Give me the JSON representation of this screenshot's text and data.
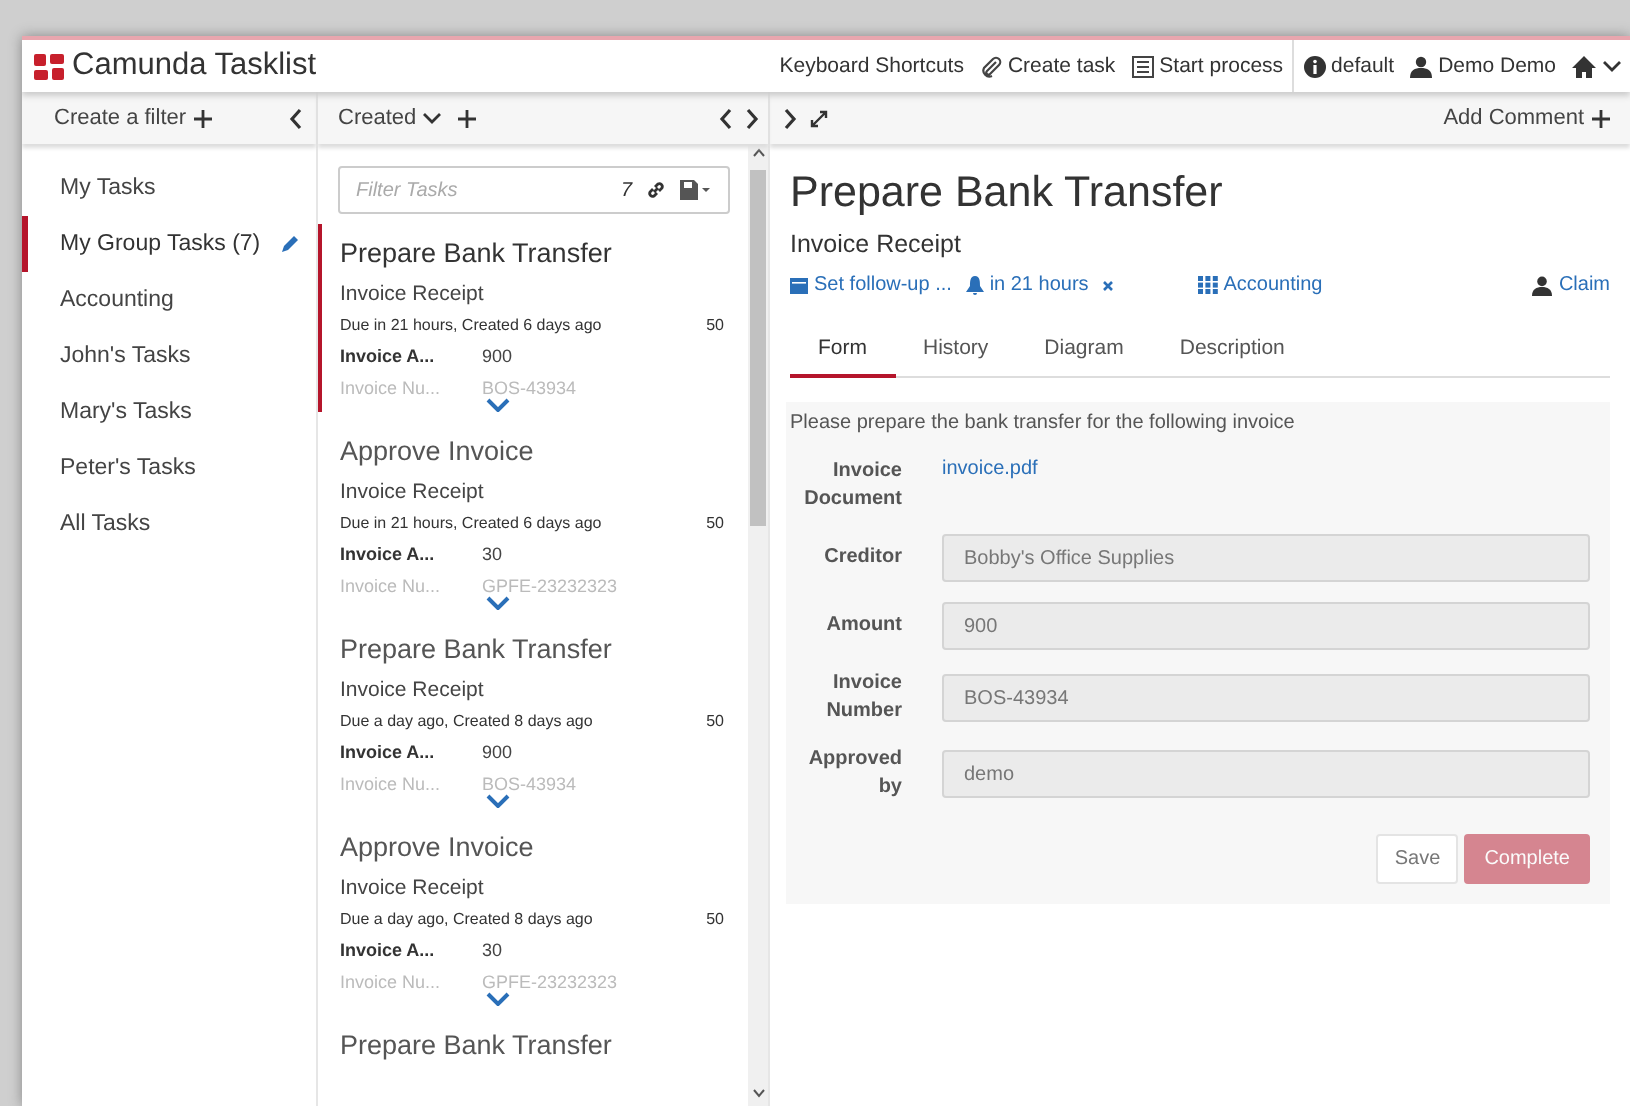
{
  "header": {
    "brand": "Camunda Tasklist",
    "links": [
      {
        "kind": "keyboard",
        "label": "Keyboard Shortcuts"
      },
      {
        "kind": "create",
        "label": "Create task"
      },
      {
        "kind": "start",
        "label": "Start process"
      },
      {
        "kind": "engine",
        "label": "default"
      },
      {
        "kind": "user",
        "label": "Demo Demo"
      },
      {
        "kind": "home"
      }
    ]
  },
  "filters": {
    "create_label": "Create a filter",
    "items": [
      {
        "label": "My Tasks",
        "selected": false
      },
      {
        "label": "My Group Tasks",
        "count": "(7)",
        "selected": true
      },
      {
        "label": "Accounting",
        "selected": false
      },
      {
        "label": "John's Tasks",
        "selected": false
      },
      {
        "label": "Mary's Tasks",
        "selected": false
      },
      {
        "label": "Peter's Tasks",
        "selected": false
      },
      {
        "label": "All Tasks",
        "selected": false
      }
    ]
  },
  "list": {
    "sort_label": "Created",
    "filter": {
      "placeholder": "Filter Tasks",
      "count": "7"
    },
    "tasks": [
      {
        "name": "Prepare Bank Transfer",
        "process": "Invoice Receipt",
        "due": "Due in 21 hours, Created 6 days ago",
        "priority": "50",
        "variables": [
          {
            "label": "Invoice A...",
            "value": "900"
          },
          {
            "label": "Invoice Nu...",
            "value": "BOS-43934"
          }
        ],
        "expanded": false,
        "selected": true
      },
      {
        "name": "Approve Invoice",
        "process": "Invoice Receipt",
        "due": "Due in 21 hours, Created 6 days ago",
        "priority": "50",
        "variables": [
          {
            "label": "Invoice A...",
            "value": "30"
          },
          {
            "label": "Invoice Nu...",
            "value": "GPFE-23232323"
          }
        ],
        "expanded": false,
        "selected": false
      },
      {
        "name": "Prepare Bank Transfer",
        "process": "Invoice Receipt",
        "due": "Due a day ago, Created 8 days ago",
        "priority": "50",
        "variables": [
          {
            "label": "Invoice A...",
            "value": "900"
          },
          {
            "label": "Invoice Nu...",
            "value": "BOS-43934"
          }
        ],
        "expanded": false,
        "selected": false
      },
      {
        "name": "Approve Invoice",
        "process": "Invoice Receipt",
        "due": "Due a day ago, Created 8 days ago",
        "priority": "50",
        "variables": [
          {
            "label": "Invoice A...",
            "value": "30"
          },
          {
            "label": "Invoice Nu...",
            "value": "GPFE-23232323"
          }
        ],
        "expanded": false,
        "selected": false
      },
      {
        "name": "Prepare Bank Transfer",
        "selected": false
      }
    ]
  },
  "detail": {
    "add_comment": "Add Comment",
    "title": "Prepare Bank Transfer",
    "process": "Invoice Receipt",
    "actions": [
      {
        "kind": "follow-up",
        "label": "Set follow-up ..."
      },
      {
        "kind": "due",
        "label": "in 21 hours",
        "removable": true
      },
      {
        "kind": "group",
        "label": "Accounting"
      },
      {
        "kind": "claim",
        "label": "Claim"
      }
    ],
    "tabs": [
      {
        "label": "Form",
        "selected": true
      },
      {
        "label": "History",
        "selected": false
      },
      {
        "label": "Diagram",
        "selected": false
      },
      {
        "label": "Description",
        "selected": false
      }
    ],
    "form": {
      "description": "Please prepare the bank transfer for the following invoice",
      "fields": [
        {
          "kind": "link",
          "label": "Invoice Document",
          "value": "invoice.pdf"
        },
        {
          "kind": "input",
          "label": "Creditor",
          "value": "Bobby's Office Supplies",
          "disabled": true
        },
        {
          "kind": "input",
          "label": "Amount",
          "value": "900",
          "disabled": true
        },
        {
          "kind": "input",
          "label": "Invoice Number",
          "value": "BOS-43934",
          "disabled": true
        },
        {
          "kind": "input",
          "label": "Approved by",
          "value": "demo",
          "disabled": true
        }
      ],
      "buttons": [
        {
          "kind": "default",
          "label": "Save",
          "disabled": true
        },
        {
          "kind": "primary",
          "label": "Complete",
          "disabled": true
        }
      ]
    }
  }
}
